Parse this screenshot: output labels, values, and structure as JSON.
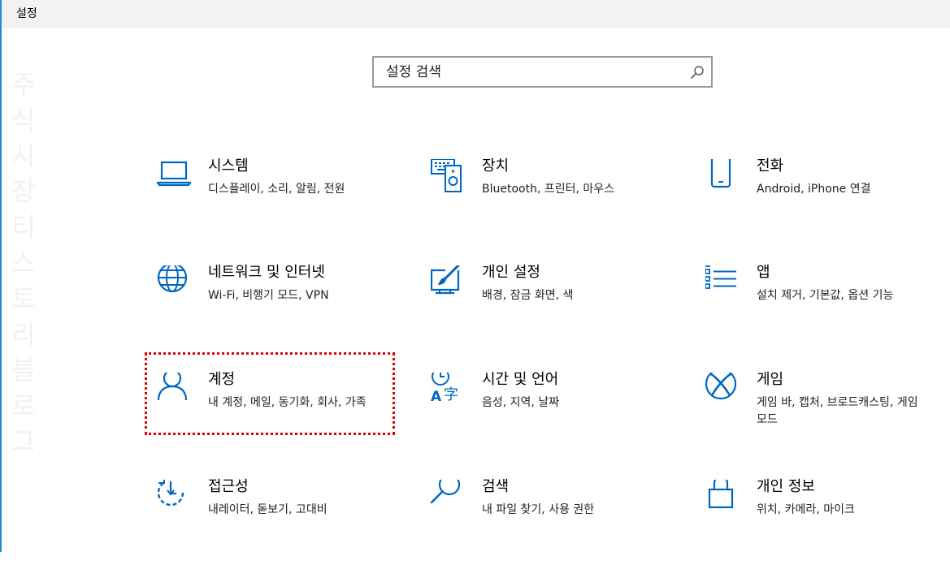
{
  "window": {
    "title": "설정"
  },
  "watermark": {
    "chars": [
      "주",
      "식",
      "시",
      "장",
      "티",
      "스",
      "토",
      "리",
      "블",
      "로",
      "그"
    ]
  },
  "search": {
    "placeholder": "설정 검색"
  },
  "tiles": [
    {
      "title": "시스템",
      "desc": "디스플레이, 소리, 알림, 전원",
      "icon": "laptop-icon"
    },
    {
      "title": "장치",
      "desc": "Bluetooth, 프린터, 마우스",
      "icon": "devices-icon"
    },
    {
      "title": "전화",
      "desc": "Android, iPhone 연결",
      "icon": "phone-icon"
    },
    {
      "title": "네트워크 및 인터넷",
      "desc": "Wi-Fi, 비행기 모드, VPN",
      "icon": "globe-icon"
    },
    {
      "title": "개인 설정",
      "desc": "배경, 잠금 화면, 색",
      "icon": "paint-brush-icon"
    },
    {
      "title": "앱",
      "desc": "설치 제거, 기본값, 옵션 기능",
      "icon": "apps-list-icon"
    },
    {
      "title": "계정",
      "desc": "내 계정, 메일, 동기화, 회사, 가족",
      "icon": "person-icon"
    },
    {
      "title": "시간 및 언어",
      "desc": "음성, 지역, 날짜",
      "icon": "time-language-icon"
    },
    {
      "title": "게임",
      "desc": "게임 바, 캡처, 브로드캐스팅, 게임 모드",
      "icon": "xbox-icon"
    },
    {
      "title": "접근성",
      "desc": "내레이터, 돋보기, 고대비",
      "icon": "ease-of-access-icon"
    },
    {
      "title": "검색",
      "desc": "내 파일 찾기, 사용 권한",
      "icon": "magnifier-icon"
    },
    {
      "title": "개인 정보",
      "desc": "위치, 카메라, 마이크",
      "icon": "lock-icon"
    }
  ],
  "colors": {
    "accent": "#0067c0",
    "focus": "#e00000",
    "titlebar": "#f2f2f2"
  }
}
